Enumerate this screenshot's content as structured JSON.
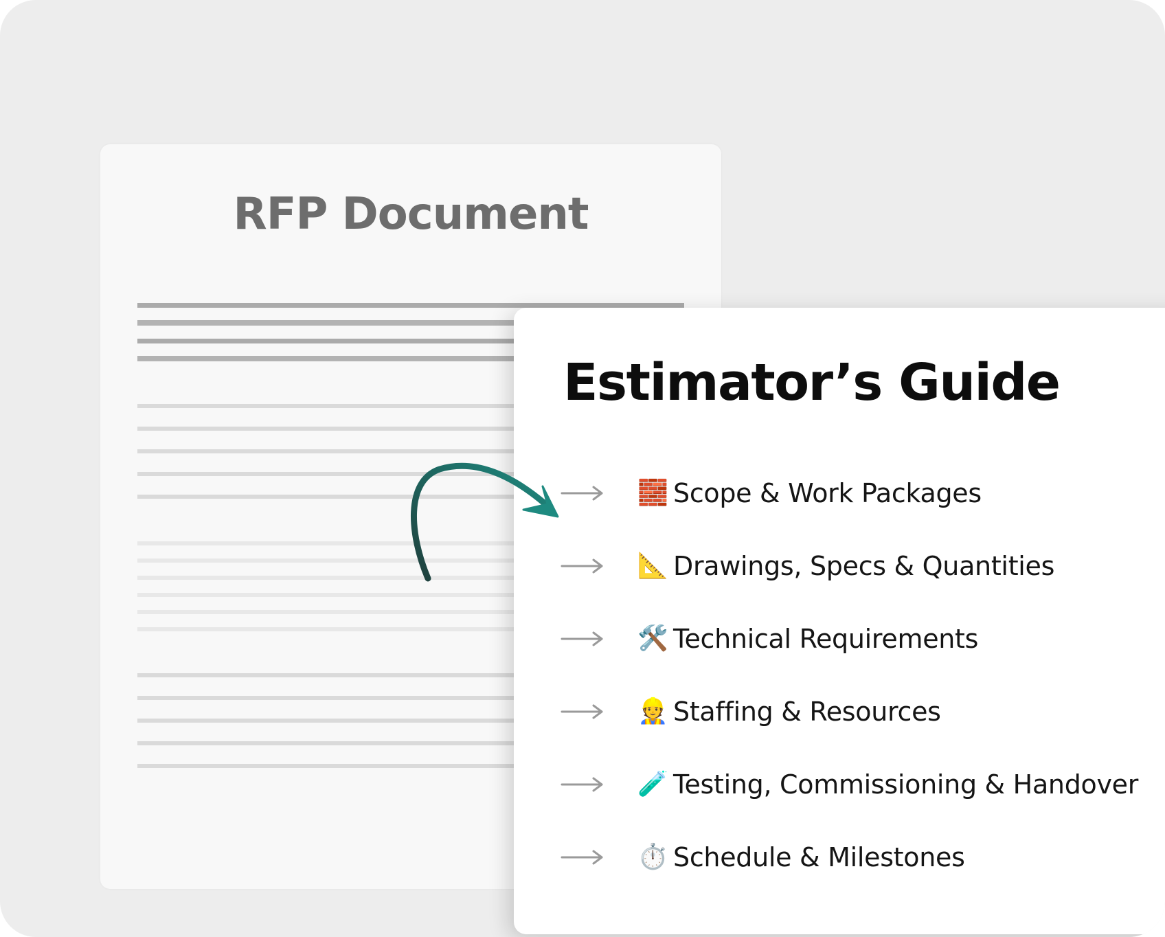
{
  "rfp_document": {
    "title": "RFP Document"
  },
  "estimators_guide": {
    "title": "Estimator’s Guide",
    "items": [
      {
        "icon": "bricks-icon",
        "emoji": "🧱",
        "label": "Scope & Work Packages"
      },
      {
        "icon": "triangular-ruler-icon",
        "emoji": "📐",
        "label": "Drawings, Specs & Quantities"
      },
      {
        "icon": "hammer-and-wrench-icon",
        "emoji": "🛠️",
        "label": "Technical Requirements"
      },
      {
        "icon": "construction-worker-icon",
        "emoji": "👷",
        "label": "Staffing & Resources"
      },
      {
        "icon": "test-tube-icon",
        "emoji": "🧪",
        "label": "Testing, Commissioning & Handover"
      },
      {
        "icon": "stopwatch-icon",
        "emoji": "⏱️",
        "label": "Schedule & Milestones"
      }
    ]
  },
  "colors": {
    "background": "#ededed",
    "document_card": "#f8f8f8",
    "guide_card": "#ffffff",
    "curved_arrow": "#1e6e68",
    "list_arrow": "#9a9a9a"
  }
}
